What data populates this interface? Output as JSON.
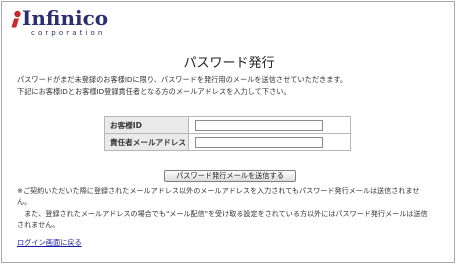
{
  "header": {
    "logo_name": "Infinico",
    "logo_sub": "corporation"
  },
  "page_title": "パスワード発行",
  "intro": {
    "line1": "パスワードがまだ未登録のお客様IDに限り、パスワードを発行用のメールを送信させていただきます。",
    "line2": "下記にお客様IDとお客様ID登録責任者となる方のメールアドレスを入力して下さい。"
  },
  "form": {
    "customer_id_label": "お客様ID",
    "customer_id_value": "",
    "email_label": "責任者メールアドレス",
    "email_value": "",
    "submit_label": "パスワード発行メールを送信する"
  },
  "notes": {
    "line1": "※ご契約いただいた際に登録されたメールアドレス以外のメールアドレスを入力されてもパスワード発行メールは送信されませ",
    "line2": "ん。",
    "line3": "　また、登録されたメールアドレスの場合でも\"メール配信\"を受け取る設定をされている方以外にはパスワード発行メールは送信",
    "line4": "されません。"
  },
  "back_link": "ログイン画面に戻る",
  "colors": {
    "logo": "#2c2f6e",
    "logo_mark": "#c62a2a",
    "link": "#1a1aa8",
    "label_bg": "#eaeaea"
  }
}
